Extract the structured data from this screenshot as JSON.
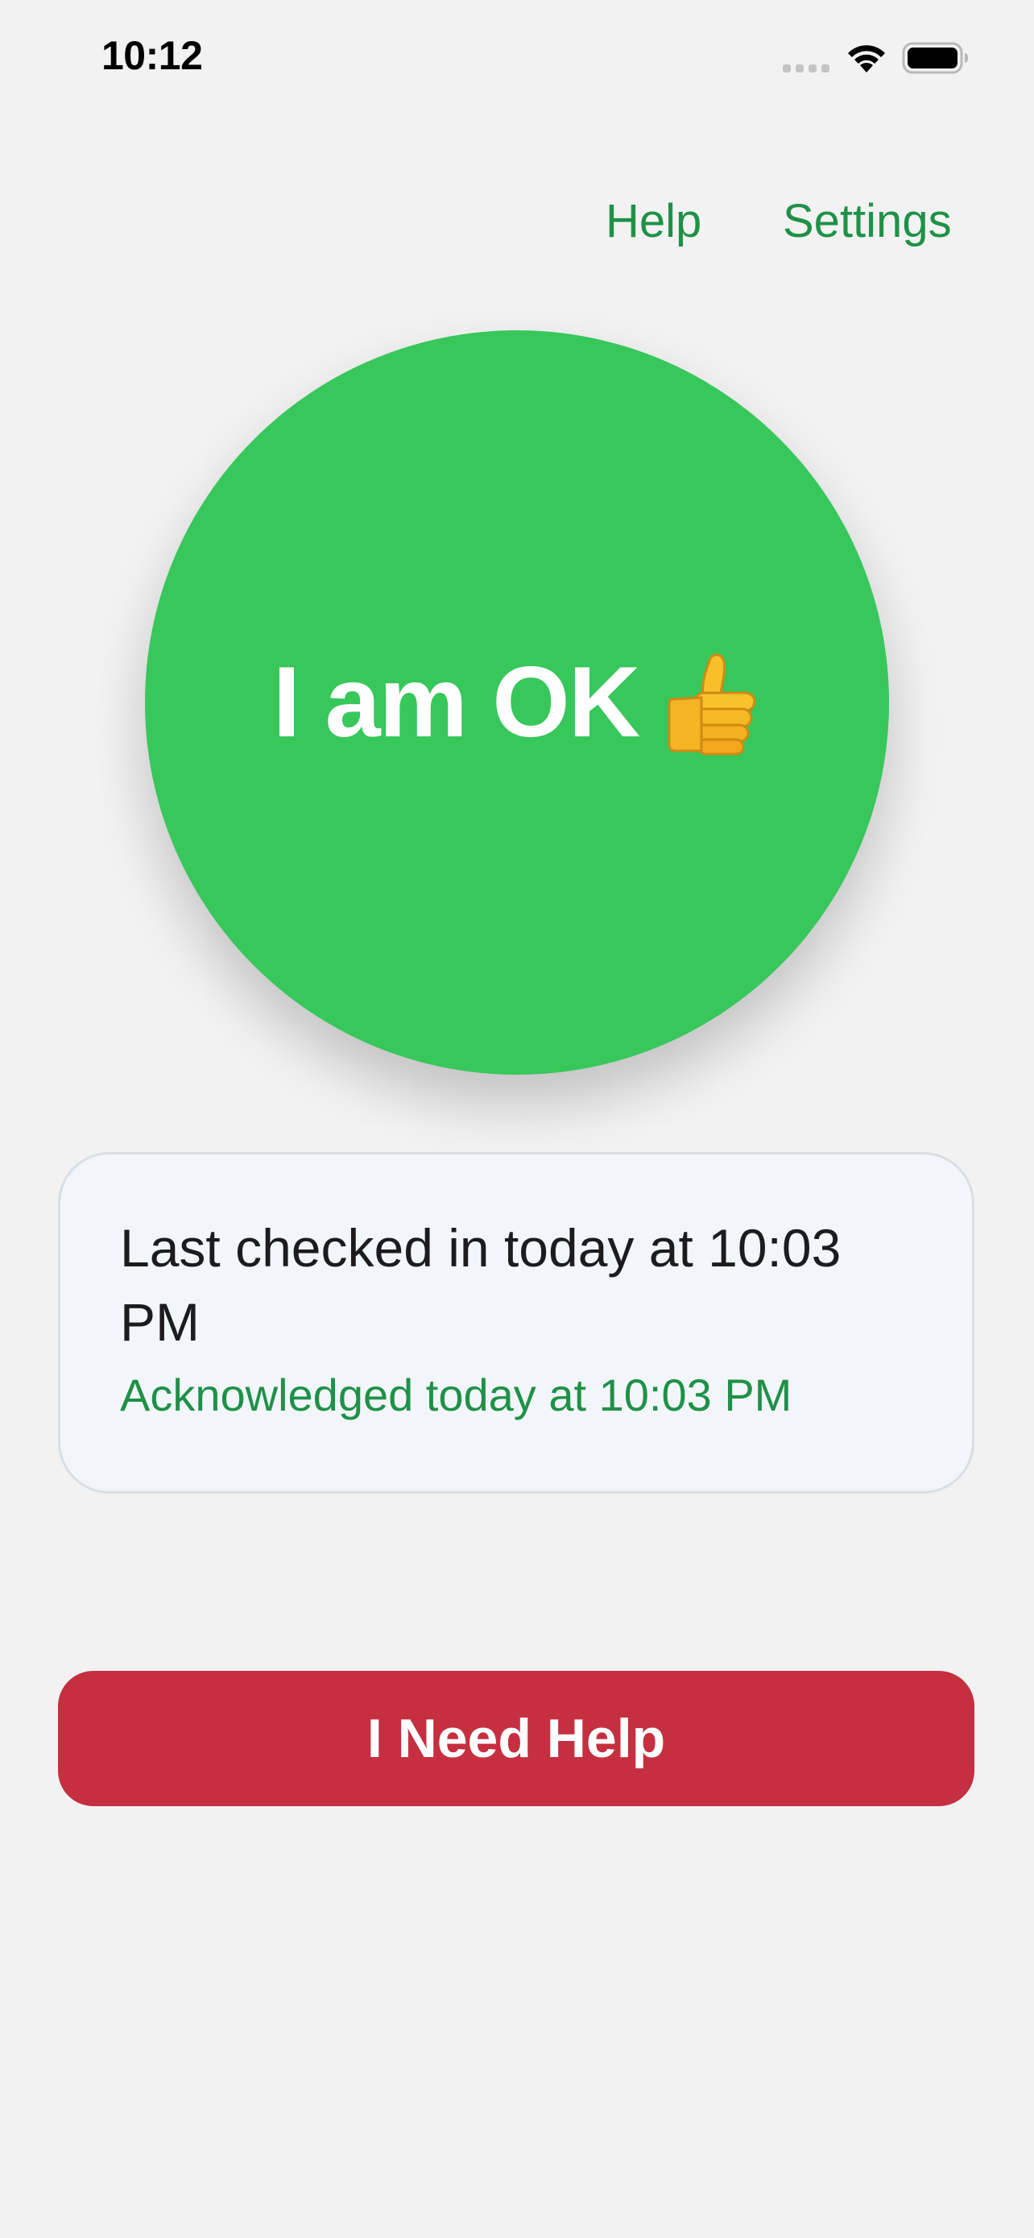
{
  "status_bar": {
    "time": "10:12",
    "icons": [
      "signal-icon",
      "wifi-icon",
      "battery-icon"
    ]
  },
  "nav": {
    "help_label": "Help",
    "settings_label": "Settings"
  },
  "ok_button": {
    "label": "I am OK",
    "icon": "thumbs-up-icon"
  },
  "status_card": {
    "last_checked": "Last checked in today at 10:03 PM",
    "acknowledged": "Acknowledged today at 10:03 PM"
  },
  "help_button": {
    "label": "I Need Help"
  },
  "colors": {
    "background": "#f2f2f2",
    "accent_green": "#1f9147",
    "ok_green": "#37c75b",
    "alert_red": "#c52f3f",
    "card_background": "#f2f6fa"
  }
}
